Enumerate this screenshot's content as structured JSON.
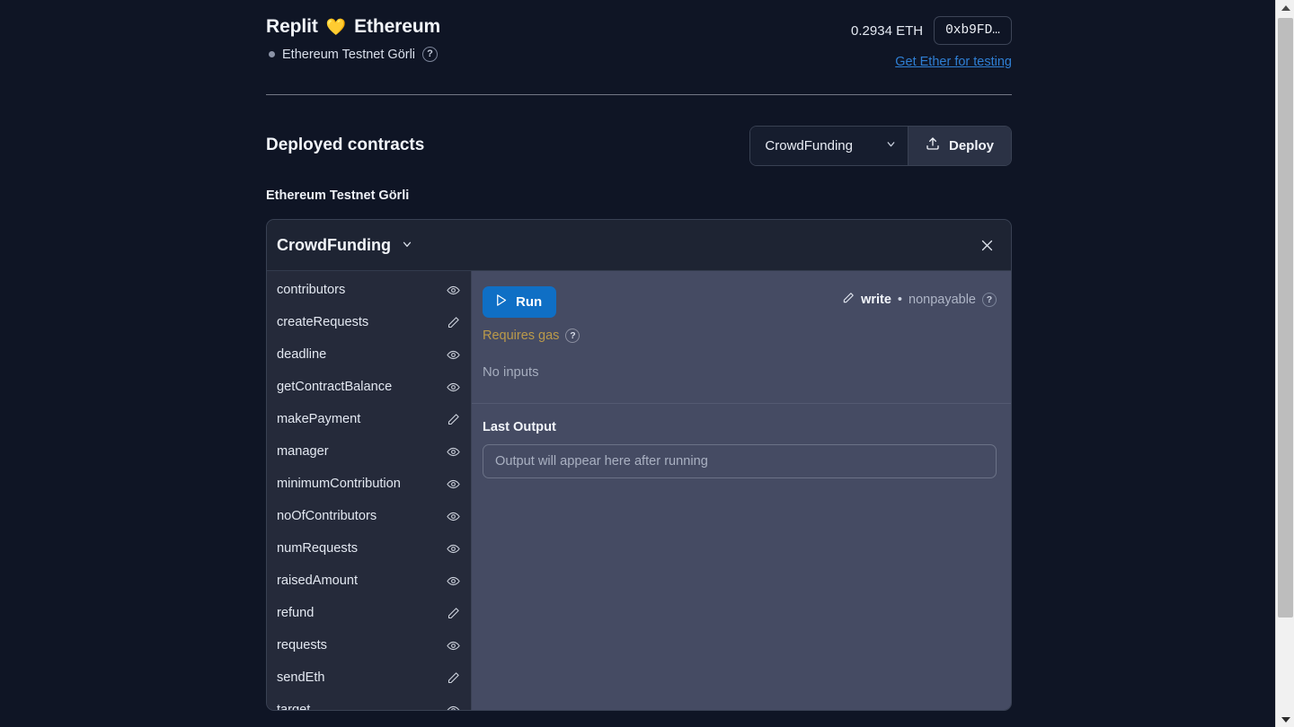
{
  "header": {
    "brand_name": "Replit",
    "heart_icon": "yellow-heart",
    "product_name": "Ethereum",
    "network_name": "Ethereum Testnet Görli",
    "network_help": "?",
    "balance": "0.2934 ETH",
    "address_short": "0xb9FD…",
    "faucet_link": "Get Ether for testing"
  },
  "deploy": {
    "section_title": "Deployed contracts",
    "selected_contract": "CrowdFunding",
    "select_chevron": "chevron-down-icon",
    "deploy_label": "Deploy",
    "deploy_icon": "upload-icon",
    "network_group_label": "Ethereum Testnet Görli"
  },
  "contract_card": {
    "title": "CrowdFunding",
    "title_chevron": "chevron-down-icon",
    "close_icon": "close-icon",
    "functions": [
      {
        "name": "contributors",
        "kind": "read",
        "icon": "eye-icon"
      },
      {
        "name": "createRequests",
        "kind": "write",
        "icon": "pencil-icon"
      },
      {
        "name": "deadline",
        "kind": "read",
        "icon": "eye-icon"
      },
      {
        "name": "getContractBalance",
        "kind": "read",
        "icon": "eye-icon"
      },
      {
        "name": "makePayment",
        "kind": "write",
        "icon": "pencil-icon"
      },
      {
        "name": "manager",
        "kind": "read",
        "icon": "eye-icon"
      },
      {
        "name": "minimumContribution",
        "kind": "read",
        "icon": "eye-icon"
      },
      {
        "name": "noOfContributors",
        "kind": "read",
        "icon": "eye-icon"
      },
      {
        "name": "numRequests",
        "kind": "read",
        "icon": "eye-icon"
      },
      {
        "name": "raisedAmount",
        "kind": "read",
        "icon": "eye-icon"
      },
      {
        "name": "refund",
        "kind": "write",
        "icon": "pencil-icon"
      },
      {
        "name": "requests",
        "kind": "read",
        "icon": "eye-icon"
      },
      {
        "name": "sendEth",
        "kind": "write",
        "icon": "pencil-icon"
      },
      {
        "name": "target",
        "kind": "read",
        "icon": "eye-icon"
      }
    ],
    "detail": {
      "run_label": "Run",
      "run_icon": "play-icon",
      "mutability_icon": "pencil-icon",
      "mutability_write": "write",
      "mutability_separator": "•",
      "mutability_payable": "nonpayable",
      "mutability_help": "?",
      "gas_text": "Requires gas",
      "gas_help": "?",
      "inputs_text": "No inputs",
      "output_label": "Last Output",
      "output_placeholder": "Output will appear here after running"
    }
  },
  "scrollbar": {
    "up_arrow": "scroll-up-arrow",
    "down_arrow": "scroll-down-arrow",
    "thumb": "scroll-thumb"
  },
  "colors": {
    "page_bg": "#0f1525",
    "panel_bg": "#252a3a",
    "detail_bg": "#454b63",
    "accent_blue": "#0f6fc5",
    "link_blue": "#2f7fd4",
    "gas_amber": "#bb9a4a",
    "heart_yellow": "#f5c542"
  }
}
